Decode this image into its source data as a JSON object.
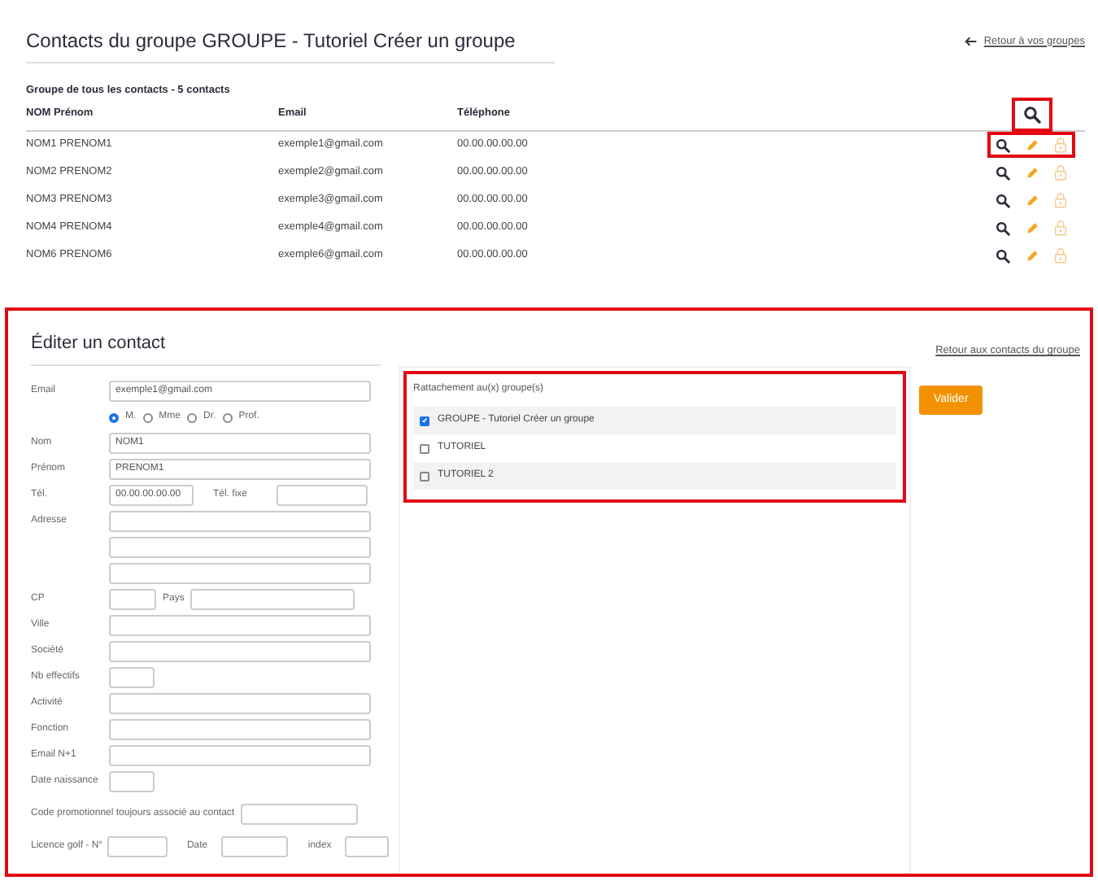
{
  "header": {
    "title": "Contacts du groupe GROUPE - Tutoriel Créer un groupe",
    "back_link": "Retour à vos groupes"
  },
  "contacts": {
    "summary": "Groupe de tous les contacts - 5 contacts",
    "columns": [
      "NOM Prénom",
      "Email",
      "Téléphone"
    ],
    "search_highlighted": true,
    "rows": [
      {
        "cells": [
          "NOM1 PRENOM1",
          "exemple1@gmail.com",
          "00.00.00.00.00"
        ],
        "highlighted": true
      },
      {
        "cells": [
          "NOM2 PRENOM2",
          "exemple2@gmail.com",
          "00.00.00.00.00"
        ],
        "highlighted": false
      },
      {
        "cells": [
          "NOM3 PRENOM3",
          "exemple3@gmail.com",
          "00.00.00.00.00"
        ],
        "highlighted": false
      },
      {
        "cells": [
          "NOM4 PRENOM4",
          "exemple4@gmail.com",
          "00.00.00.00.00"
        ],
        "highlighted": false
      },
      {
        "cells": [
          "NOM6 PRENOM6",
          "exemple6@gmail.com",
          "00.00.00.00.00"
        ],
        "highlighted": false
      }
    ]
  },
  "edit": {
    "title": "Éditer un contact",
    "back_link": "Retour aux contacts du groupe",
    "highlighted": true,
    "fields": [
      {
        "kind": "text",
        "label": "Email",
        "value": "exemple1@gmail.com"
      },
      {
        "kind": "radios",
        "options": [
          {
            "label": "M.",
            "selected": true
          },
          {
            "label": "Mme",
            "selected": false
          },
          {
            "label": "Dr.",
            "selected": false
          },
          {
            "label": "Prof.",
            "selected": false
          }
        ]
      },
      {
        "kind": "text",
        "label": "Nom",
        "value": "NOM1"
      },
      {
        "kind": "text",
        "label": "Prénom",
        "value": "PRENOM1"
      },
      {
        "kind": "phone",
        "label": "Tél.",
        "value": "00.00.00.00.00",
        "label_2": "Tél. fixe"
      },
      {
        "kind": "text",
        "label": "Adresse"
      },
      {
        "kind": "text"
      },
      {
        "kind": "text"
      },
      {
        "kind": "postal",
        "label": "CP",
        "label_2": "Pays"
      },
      {
        "kind": "text",
        "label": "Ville"
      },
      {
        "kind": "text",
        "label": "Société"
      },
      {
        "kind": "short",
        "label": "Nb effectifs"
      },
      {
        "kind": "text",
        "label": "Activité"
      },
      {
        "kind": "text",
        "label": "Fonction"
      },
      {
        "kind": "text",
        "label": "Email N+1"
      },
      {
        "kind": "short",
        "label": "Date naissance"
      },
      {
        "kind": "wide-label",
        "label": "Code promotionnel toujours associé au contact"
      },
      {
        "kind": "licence",
        "label": "Licence golf - N°",
        "label_2": "Date",
        "label_3": "index"
      }
    ],
    "groups_panel": {
      "title": "Rattachement au(x) groupe(s)",
      "highlighted": true,
      "groups": [
        {
          "label": "GROUPE - Tutoriel Créer un groupe",
          "checked": true
        },
        {
          "label": "TUTORIEL",
          "checked": false
        },
        {
          "label": "TUTORIEL 2",
          "checked": false
        }
      ]
    },
    "submit": "Valider"
  }
}
